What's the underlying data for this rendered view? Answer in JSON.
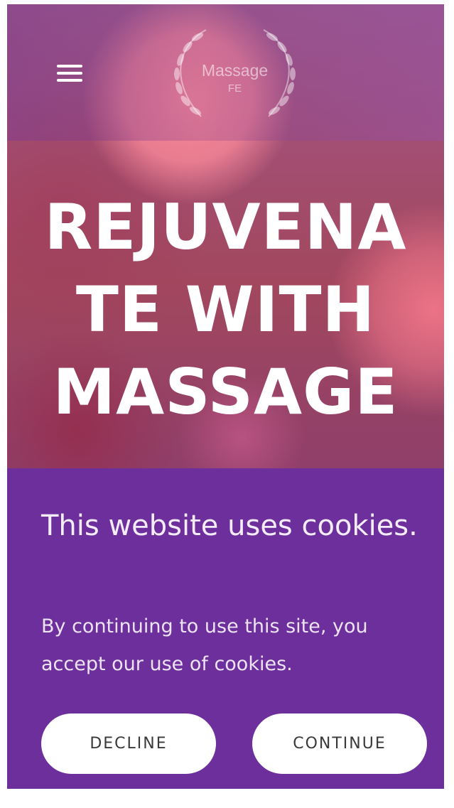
{
  "header": {
    "menu_icon": "hamburger-menu-icon",
    "logo": {
      "line1": "Massage",
      "line2": "FE",
      "ornament_icon": "laurel-wreath-icon"
    }
  },
  "hero": {
    "headline_lines": [
      "REJUVENA",
      "TE WITH",
      "MASSAGE"
    ]
  },
  "cookie_banner": {
    "title": "This website uses cookies.",
    "body": "By continuing to use this site, you accept our use of cookies.",
    "decline_label": "DECLINE",
    "continue_label": "CONTINUE"
  },
  "colors": {
    "banner_bg": "#6d2f9c",
    "button_bg": "#ffffff",
    "button_text": "#3a3a3a"
  }
}
